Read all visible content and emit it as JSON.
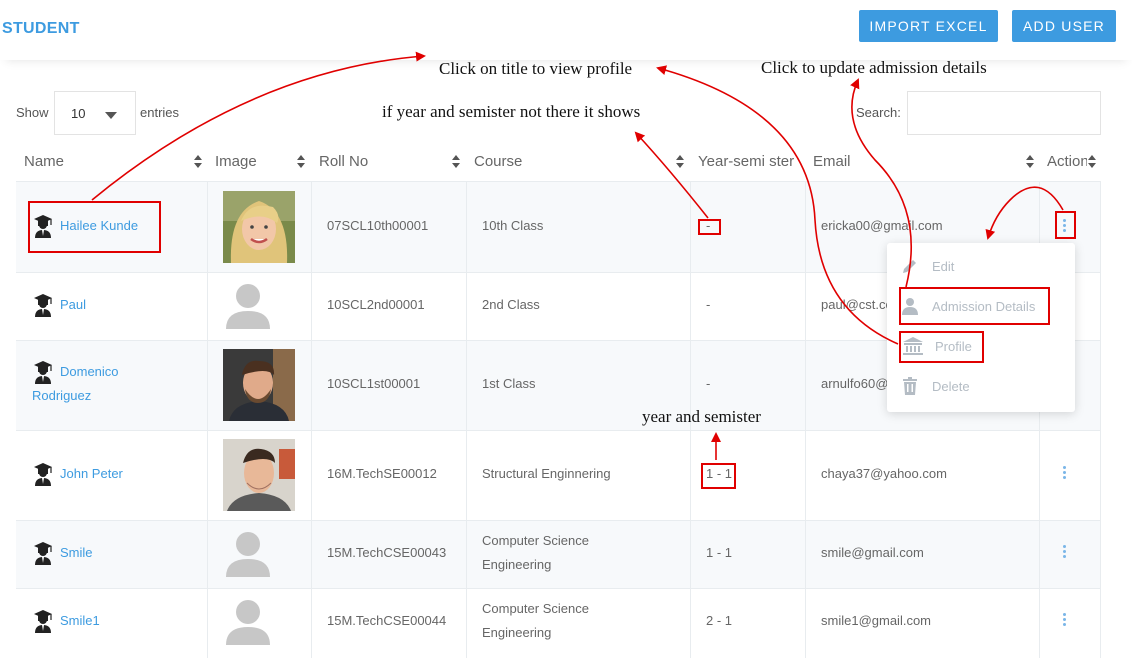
{
  "page": {
    "title": "STUDENT"
  },
  "header": {
    "import_label": "IMPORT EXCEL",
    "add_user_label": "ADD USER"
  },
  "controls": {
    "show_label": "Show",
    "entries_value": "10",
    "entries_label": "entries",
    "search_label": "Search:",
    "search_value": ""
  },
  "table": {
    "columns": [
      "Name",
      "Image",
      "Roll No",
      "Course",
      "Year-semi ster",
      "Email",
      "Action"
    ],
    "rows": [
      {
        "name": "Hailee Kunde",
        "image": "photo-blonde-woman",
        "roll": "07SCL10th00001",
        "course": "10th Class",
        "year": "-",
        "email": "ericka00@gmail.com"
      },
      {
        "name": "Paul",
        "image": "avatar-placeholder",
        "roll": "10SCL2nd00001",
        "course": "2nd Class",
        "year": "-",
        "email": "paul@cst.co"
      },
      {
        "name": "Domenico",
        "name2": "Rodriguez",
        "image": "photo-man-beard",
        "roll": "10SCL1st00001",
        "course": "1st Class",
        "year": "-",
        "email": "arnulfo60@"
      },
      {
        "name": "John Peter",
        "image": "photo-man-short-hair",
        "roll": "16M.TechSE00012",
        "course": "Structural Enginnering",
        "year": "1 - 1",
        "email": "chaya37@yahoo.com"
      },
      {
        "name": "Smile",
        "image": "avatar-placeholder",
        "roll": "15M.TechCSE00043",
        "course": "Computer Science",
        "course2": "Engineering",
        "year": "1 - 1",
        "email": "smile@gmail.com"
      },
      {
        "name": "Smile1",
        "image": "avatar-placeholder",
        "roll": "15M.TechCSE00044",
        "course": "Computer Science",
        "course2": "Engineering",
        "year": "2 - 1",
        "email": "smile1@gmail.com"
      }
    ]
  },
  "action_menu": {
    "items": [
      {
        "label": "Edit",
        "icon": "pencil-icon"
      },
      {
        "label": "Admission Details",
        "icon": "user-icon"
      },
      {
        "label": "Profile",
        "icon": "bank-icon"
      },
      {
        "label": "Delete",
        "icon": "trash-icon"
      }
    ]
  },
  "annotations": {
    "title_note": "Click on title to view profile",
    "admission_note": "Click to update admission details",
    "year_missing_note": "if year and semister not there it shows",
    "year_note": "year and semister"
  },
  "colors": {
    "accent": "#3d9be0",
    "highlight": "#e00000"
  }
}
